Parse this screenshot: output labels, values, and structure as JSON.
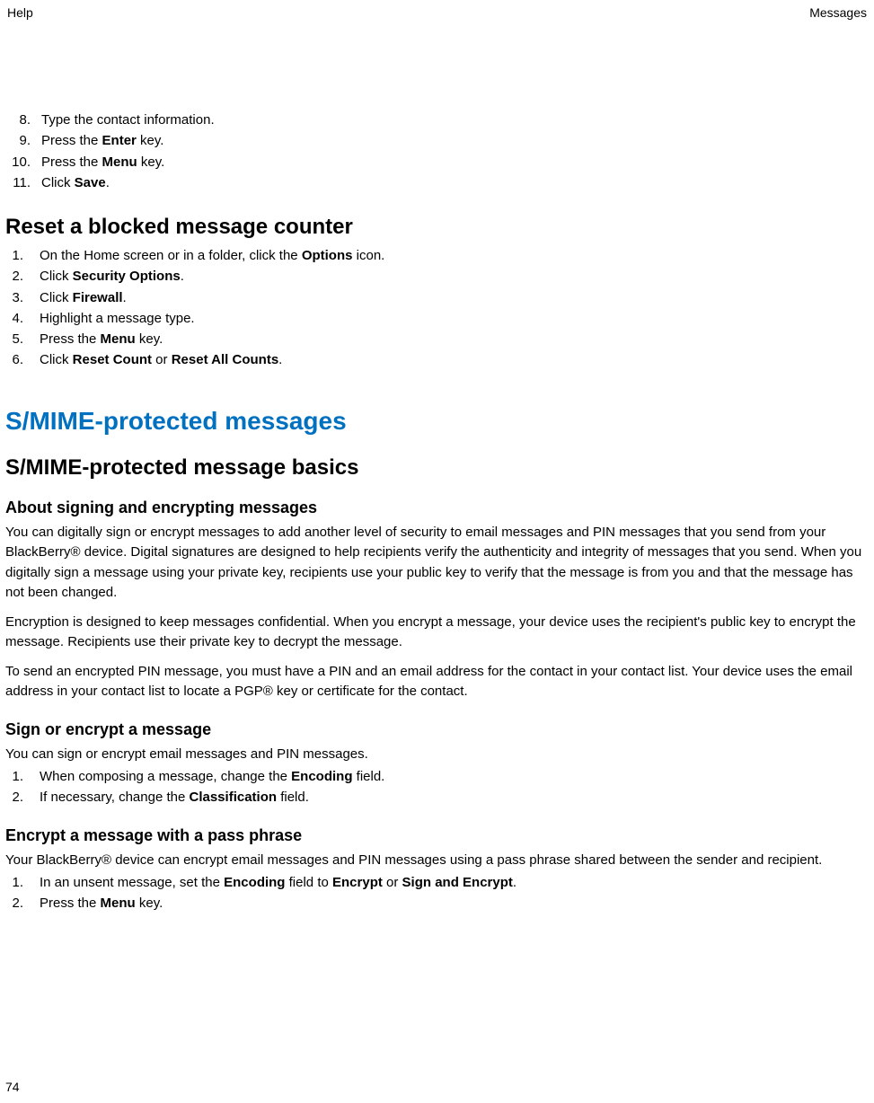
{
  "header": {
    "left": "Help",
    "right": "Messages"
  },
  "topList": [
    {
      "num": "8.",
      "parts": [
        "Type the contact information."
      ]
    },
    {
      "num": "9.",
      "parts": [
        "Press the ",
        {
          "b": "Enter"
        },
        " key."
      ]
    },
    {
      "num": "10.",
      "parts": [
        "Press the ",
        {
          "b": "Menu"
        },
        " key."
      ]
    },
    {
      "num": "11.",
      "parts": [
        "Click ",
        {
          "b": "Save"
        },
        "."
      ]
    }
  ],
  "resetHeading": "Reset a blocked message counter",
  "resetList": [
    {
      "num": "1.",
      "parts": [
        "On the Home screen or in a folder, click the ",
        {
          "b": "Options"
        },
        " icon."
      ]
    },
    {
      "num": "2.",
      "parts": [
        "Click ",
        {
          "b": "Security Options"
        },
        "."
      ]
    },
    {
      "num": "3.",
      "parts": [
        "Click ",
        {
          "b": "Firewall"
        },
        "."
      ]
    },
    {
      "num": "4.",
      "parts": [
        "Highlight a message type."
      ]
    },
    {
      "num": "5.",
      "parts": [
        "Press the ",
        {
          "b": "Menu"
        },
        " key."
      ]
    },
    {
      "num": "6.",
      "parts": [
        "Click ",
        {
          "b": "Reset Count"
        },
        " or ",
        {
          "b": "Reset All Counts"
        },
        "."
      ]
    }
  ],
  "chapter": "S/MIME-protected messages",
  "subHeading": "S/MIME-protected message basics",
  "aboutHeading": "About signing and encrypting messages",
  "aboutP1": "You can digitally sign or encrypt messages to add another level of security to email messages and PIN messages that you send from your BlackBerry® device. Digital signatures are designed to help recipients verify the authenticity and integrity of messages that you send. When you digitally sign a message using your private key, recipients use your public key to verify that the message is from you and that the message has not been changed.",
  "aboutP2": "Encryption is designed to keep messages confidential. When you encrypt a message, your device uses the recipient's public key to encrypt the message. Recipients use their private key to decrypt the message.",
  "aboutP3": "To send an encrypted PIN message, you must have a PIN and an email address for the contact in your contact list. Your device uses the email address in your contact list to locate a PGP® key or certificate for the contact.",
  "signHeading": "Sign or encrypt a message",
  "signIntro": "You can sign or encrypt email messages and PIN messages.",
  "signList": [
    {
      "num": "1.",
      "parts": [
        "When composing a message, change the ",
        {
          "b": "Encoding"
        },
        " field."
      ]
    },
    {
      "num": "2.",
      "parts": [
        "If necessary, change the ",
        {
          "b": "Classification"
        },
        " field."
      ]
    }
  ],
  "encryptHeading": "Encrypt a message with a pass phrase",
  "encryptIntro": "Your BlackBerry® device can encrypt email messages and PIN messages using a pass phrase shared between the sender and recipient.",
  "encryptList": [
    {
      "num": "1.",
      "parts": [
        "In an unsent message, set the ",
        {
          "b": "Encoding"
        },
        " field to ",
        {
          "b": "Encrypt"
        },
        " or ",
        {
          "b": "Sign and Encrypt"
        },
        "."
      ]
    },
    {
      "num": "2.",
      "parts": [
        "Press the ",
        {
          "b": "Menu"
        },
        " key."
      ]
    }
  ],
  "pageNumber": "74"
}
